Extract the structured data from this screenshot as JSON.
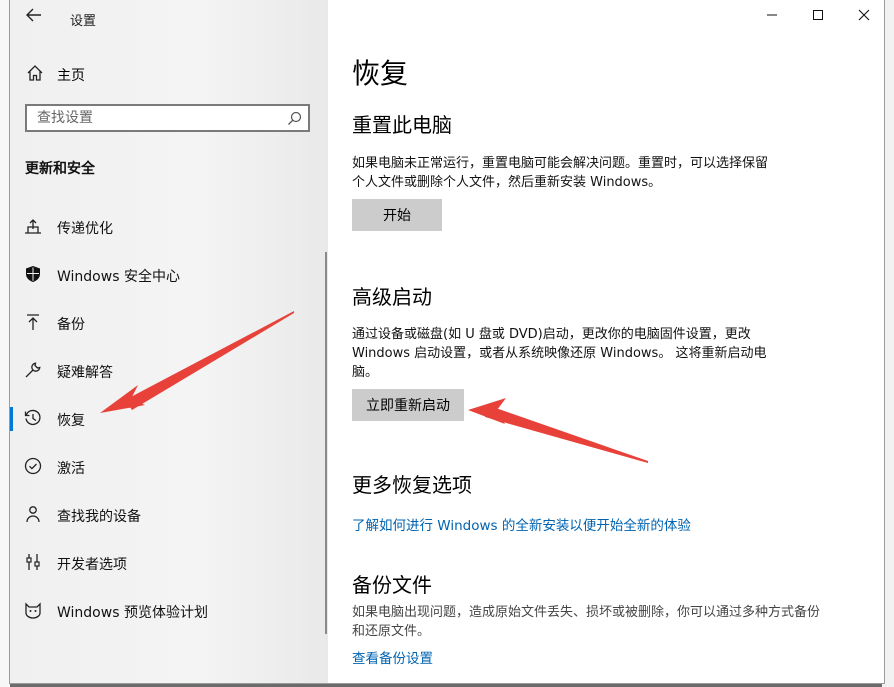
{
  "window": {
    "title": "设置",
    "controls": {
      "minimize": "—",
      "maximize": "☐",
      "close": "✕"
    }
  },
  "sidebar": {
    "home": "主页",
    "search_placeholder": "查找设置",
    "section": "更新和安全",
    "items": [
      {
        "label": "传递优化",
        "icon": "delivery-upload-icon"
      },
      {
        "label": "Windows 安全中心",
        "icon": "shield-icon"
      },
      {
        "label": "备份",
        "icon": "backup-arrow-icon"
      },
      {
        "label": "疑难解答",
        "icon": "wrench-icon"
      },
      {
        "label": "恢复",
        "icon": "history-clock-icon"
      },
      {
        "label": "激活",
        "icon": "check-circle-icon"
      },
      {
        "label": "查找我的设备",
        "icon": "person-pin-icon"
      },
      {
        "label": "开发者选项",
        "icon": "developer-sliders-icon"
      },
      {
        "label": "Windows 预览体验计划",
        "icon": "insider-cat-icon"
      }
    ],
    "active_item": "恢复"
  },
  "main": {
    "title": "恢复",
    "reset": {
      "heading": "重置此电脑",
      "desc_line1": "如果电脑未正常运行，重置电脑可能会解决问题。重置时，可以选择保留",
      "desc_line2": "个人文件或删除个人文件，然后重新安装 Windows。",
      "button": "开始"
    },
    "advanced": {
      "heading": "高级启动",
      "desc_line1": "通过设备或磁盘(如 U 盘或 DVD)启动，更改你的电脑固件设置，更改",
      "desc_line2": "Windows 启动设置，或者从系统映像还原 Windows。 这将重新启动电",
      "desc_line3": "脑。",
      "button": "立即重新启动"
    },
    "more": {
      "heading": "更多恢复选项",
      "link": "了解如何进行 Windows 的全新安装以便开始全新的体验"
    },
    "backup": {
      "heading": "备份文件",
      "desc_line1": "如果电脑出现问题，造成原始文件丢失、损坏或被删除，你可以通过多种方式备份",
      "desc_line2": "和还原文件。",
      "link": "查看备份设置"
    }
  },
  "colors": {
    "accent": "#0078d7",
    "link": "#0063b1",
    "annotation_arrow": "#e8413a"
  }
}
